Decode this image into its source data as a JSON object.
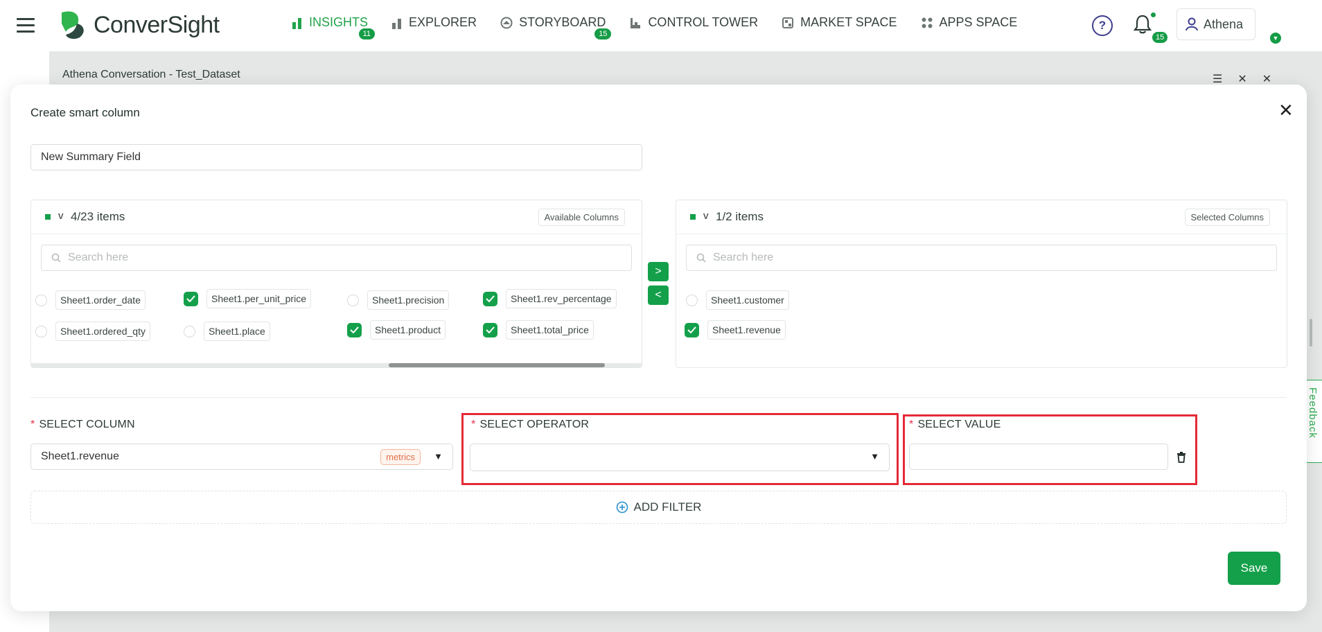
{
  "app": {
    "name": "ConverSight",
    "nav": [
      {
        "label": "INSIGHTS",
        "badge": "11",
        "active": true,
        "icon": "bar-chart-icon"
      },
      {
        "label": "EXPLORER",
        "badge": "",
        "icon": "explorer-icon"
      },
      {
        "label": "STORYBOARD",
        "badge": "15",
        "icon": "storyboard-icon"
      },
      {
        "label": "CONTROL TOWER",
        "badge": "",
        "icon": "control-tower-icon"
      },
      {
        "label": "MARKET SPACE",
        "badge": "",
        "icon": "market-icon"
      },
      {
        "label": "APPS SPACE",
        "badge": "",
        "icon": "apps-grid-icon"
      }
    ],
    "notifications_badge": "15",
    "user": "Athena",
    "colors": {
      "brand": "#14a04a",
      "highlight": "#e52a36"
    }
  },
  "background": {
    "conversation_title": "Athena Conversation - Test_Dataset",
    "feedback_label": "Feedback"
  },
  "modal": {
    "title": "Create smart column",
    "field_name_value": "New Summary Field",
    "available": {
      "count": "4/23 items",
      "tag": "Available Columns",
      "search_placeholder": "Search here",
      "items": [
        {
          "label": "Sheet1.order_date",
          "checked": false
        },
        {
          "label": "Sheet1.per_unit_price",
          "checked": true
        },
        {
          "label": "Sheet1.precision",
          "checked": false
        },
        {
          "label": "Sheet1.rev_percentage",
          "checked": true
        },
        {
          "label": "Sheet1.ordered_qty",
          "checked": false
        },
        {
          "label": "Sheet1.place",
          "checked": false
        },
        {
          "label": "Sheet1.product",
          "checked": true
        },
        {
          "label": "Sheet1.total_price",
          "checked": true
        }
      ]
    },
    "selected": {
      "count": "1/2 items",
      "tag": "Selected Columns",
      "search_placeholder": "Search here",
      "items": [
        {
          "label": "Sheet1.customer",
          "checked": false
        },
        {
          "label": "Sheet1.revenue",
          "checked": true
        }
      ]
    },
    "transfer": {
      "right": ">",
      "left": "<"
    },
    "filter": {
      "column_label": "SELECT COLUMN",
      "column_value": "Sheet1.revenue",
      "column_tag": "metrics",
      "operator_label": "SELECT OPERATOR",
      "operator_value": "",
      "value_label": "SELECT VALUE",
      "value_value": "",
      "required_mark": "*"
    },
    "add_filter_label": "ADD FILTER",
    "save_label": "Save"
  }
}
